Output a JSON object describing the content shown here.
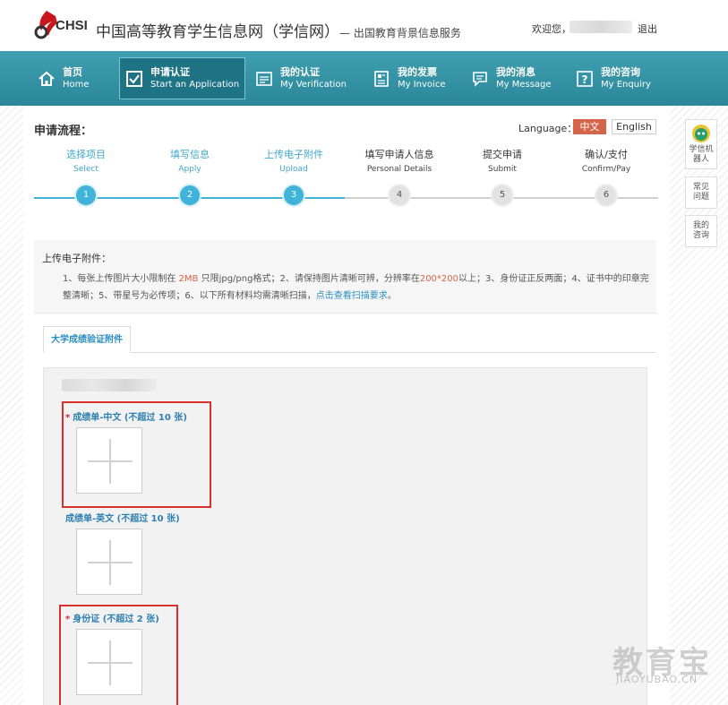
{
  "header": {
    "logo_text": "CHSI",
    "site_title": "中国高等教育学生信息网（学信网）",
    "site_subtitle": "— 出国教育背景信息服务",
    "welcome": "欢迎您，",
    "logout": "退出"
  },
  "nav": [
    {
      "zh": "首页",
      "en": "Home",
      "icon": "home-icon"
    },
    {
      "zh": "申请认证",
      "en": "Start an Application",
      "icon": "checkbox-icon"
    },
    {
      "zh": "我的认证",
      "en": "My Verification",
      "icon": "certificate-icon"
    },
    {
      "zh": "我的发票",
      "en": "My Invoice",
      "icon": "invoice-icon"
    },
    {
      "zh": "我的消息",
      "en": "My Message",
      "icon": "message-icon"
    },
    {
      "zh": "我的咨询",
      "en": "My Enquiry",
      "icon": "question-icon"
    }
  ],
  "process": {
    "title": "申请流程：",
    "language_label": "Language：",
    "lang_zh": "中文",
    "lang_en": "English",
    "steps": [
      {
        "zh": "选择项目",
        "en": "Select",
        "num": "1",
        "done": true
      },
      {
        "zh": "填写信息",
        "en": "Apply",
        "num": "2",
        "done": true
      },
      {
        "zh": "上传电子附件",
        "en": "Upload",
        "num": "3",
        "done": true
      },
      {
        "zh": "填写申请人信息",
        "en": "Personal Details",
        "num": "4",
        "done": false
      },
      {
        "zh": "提交申请",
        "en": "Submit",
        "num": "5",
        "done": false
      },
      {
        "zh": "确认/支付",
        "en": "Confirm/Pay",
        "num": "6",
        "done": false
      }
    ]
  },
  "info": {
    "title": "上传电子附件：",
    "p1": "1、每张上传图片大小限制在 ",
    "size": "2MB",
    "p2": " 只限jpg/png格式；2、请保持图片清晰可辨，分辨率在",
    "res": "200*200",
    "p3": "以上；3、身份证正反两面；4、证书中的印章完整清晰；5、带星号为必传项；6、以下所有材料均需清晰扫描，",
    "link": "点击查看扫描要求",
    "p4": "。"
  },
  "tab_label": "大学成绩验证附件",
  "fields": [
    {
      "label": "成绩单-中文 (不超过 10 张)",
      "required": "*"
    },
    {
      "label": "成绩单-英文 (不超过 10 张)",
      "required": ""
    },
    {
      "label": "身份证 (不超过 2 张)",
      "required": "*"
    }
  ],
  "sidebar": [
    {
      "label": "学信机器人",
      "icon": "robot-icon"
    },
    {
      "label": "常见问题"
    },
    {
      "label": "我的咨询"
    }
  ],
  "watermark": {
    "main": "教育宝",
    "sub": "JIAOYUBAO.CN"
  },
  "colors": {
    "nav": "#2b8799",
    "accent_blue": "#3fb3d9",
    "link": "#2d8ec0",
    "highlight": "#d4644a",
    "frame": "#d9302b"
  }
}
